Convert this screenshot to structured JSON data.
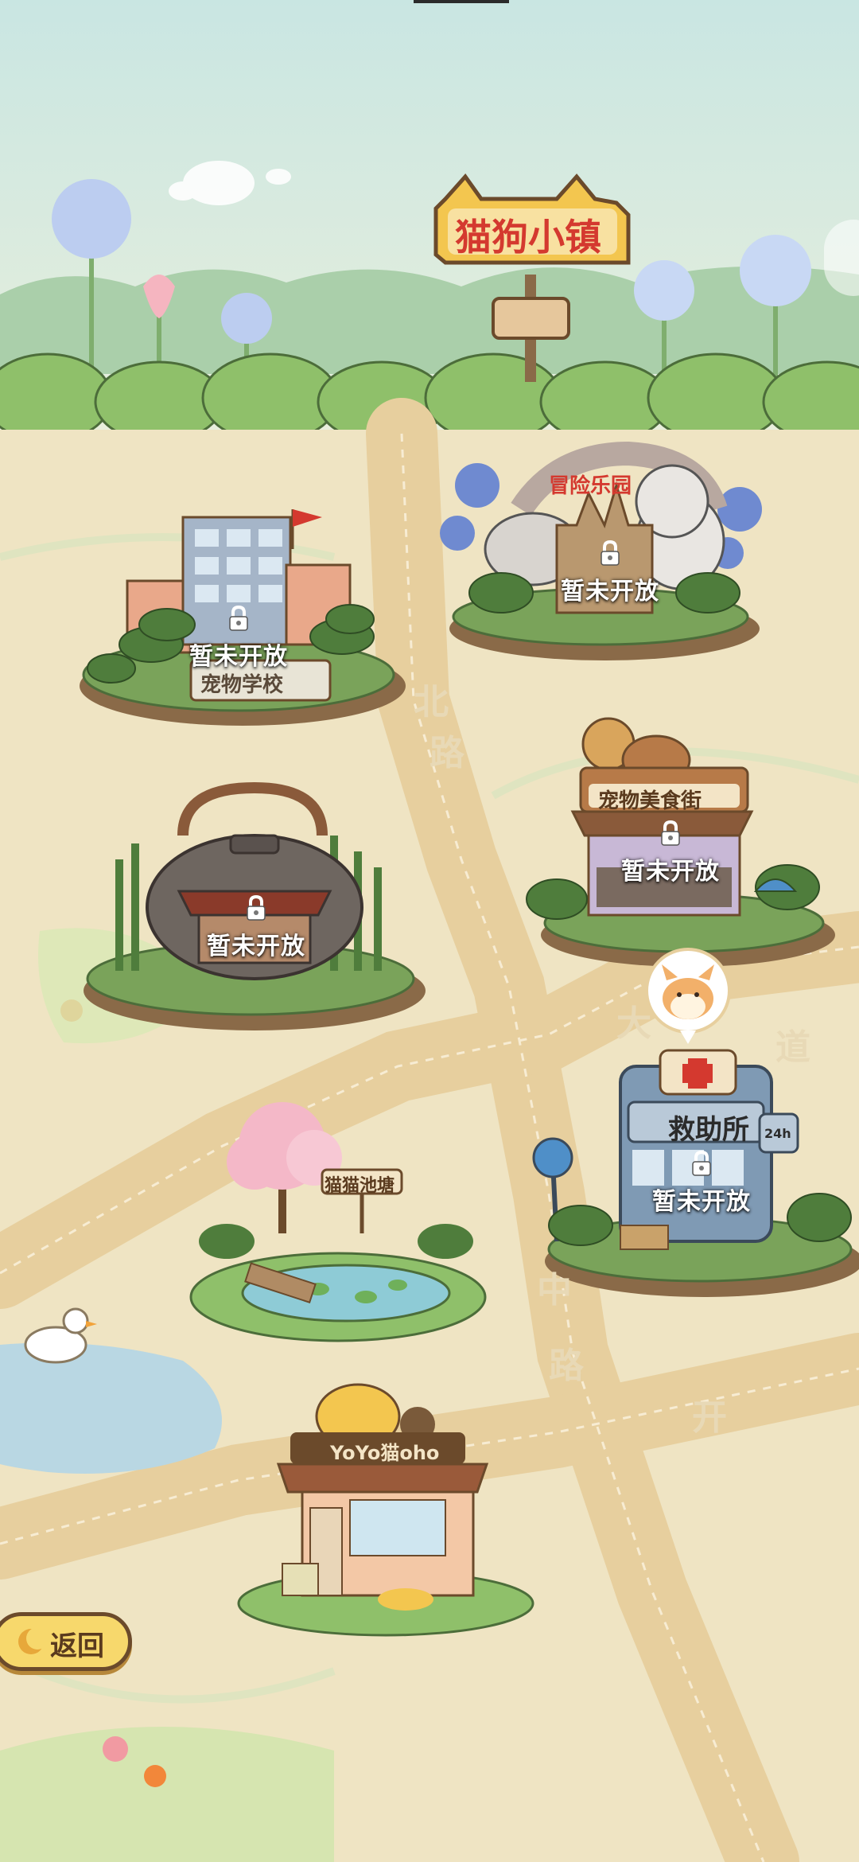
{
  "town_sign": {
    "title": "猫狗小镇"
  },
  "locations": [
    {
      "id": "school",
      "name": "宠物学校",
      "status": "暂未开放",
      "locked": true
    },
    {
      "id": "park",
      "name": "冒险乐园",
      "status": "暂未开放",
      "locked": true
    },
    {
      "id": "food-street",
      "name": "宠物美食街",
      "status": "暂未开放",
      "locked": true
    },
    {
      "id": "teahouse",
      "name": "",
      "status": "暂未开放",
      "locked": true
    },
    {
      "id": "rescue",
      "name": "救助所",
      "status": "暂未开放",
      "locked": true
    },
    {
      "id": "pond",
      "name": "猫猫池塘",
      "status": "",
      "locked": false
    },
    {
      "id": "cafe",
      "name": "YoYo猫oho",
      "status": "",
      "locked": false
    }
  ],
  "roads": {
    "north": [
      "北",
      "路"
    ],
    "avenue": [
      "大",
      "道"
    ],
    "middle": [
      "中",
      "路"
    ],
    "south": [
      "开"
    ]
  },
  "rescue_badge": "24h",
  "back_button": {
    "label": "返回"
  },
  "icons": [
    "lock-icon",
    "dog-face-icon",
    "moon-icon",
    "parking-icon",
    "cross-icon"
  ]
}
